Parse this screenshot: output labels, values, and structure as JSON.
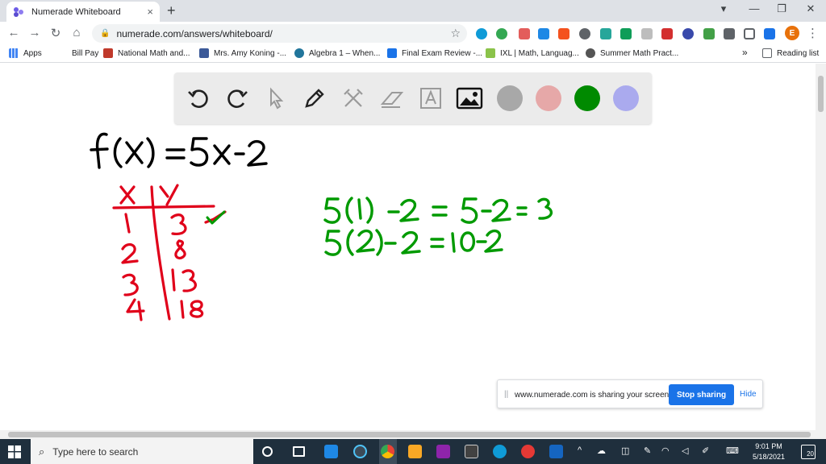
{
  "browser": {
    "tab_title": "Numerade Whiteboard",
    "tab_close": "×",
    "new_tab": "+",
    "url": "numerade.com/answers/whiteboard/",
    "profile_initial": "E"
  },
  "bookmarks": [
    {
      "label": "Apps",
      "color": "#4285f4"
    },
    {
      "label": "Bill Pay",
      "color": "#ffffff"
    },
    {
      "label": "National Math and...",
      "color": "#c0392b"
    },
    {
      "label": "Mrs. Amy Koning -...",
      "color": "#3b5998"
    },
    {
      "label": "Algebra 1 – When...",
      "color": "#21759b"
    },
    {
      "label": "Final Exam Review -...",
      "color": "#1a73e8"
    },
    {
      "label": "IXL | Math, Languag...",
      "color": "#8bc34a"
    },
    {
      "label": "Summer Math Pract...",
      "color": "#555555"
    }
  ],
  "bookmarks_more": "»",
  "reading_list": "Reading list",
  "whiteboard": {
    "swatches": [
      "#a8a8a8",
      "#e6a8a8",
      "#008a00",
      "#aaaaee"
    ],
    "ink_black": "#000000",
    "ink_red": "#e0001a",
    "ink_green": "#009a00",
    "handwriting": {
      "function": "f(x) = 5x - 2",
      "table_headers": [
        "x",
        "y"
      ],
      "table_rows": [
        [
          "1",
          "3"
        ],
        [
          "2",
          "8"
        ],
        [
          "3",
          "13"
        ],
        [
          "4",
          "18"
        ]
      ],
      "work_line_1": "5(1) -2 = 5-2 = 3",
      "work_line_2": "5(2)-2 = 10-2"
    }
  },
  "share_banner": {
    "grip": "||",
    "message": "www.numerade.com is sharing your screen.",
    "stop_label": "Stop sharing",
    "hide_label": "Hide"
  },
  "taskbar": {
    "search_placeholder": "Type here to search",
    "time": "9:01 PM",
    "date": "5/18/2021",
    "notification_count": "20"
  }
}
